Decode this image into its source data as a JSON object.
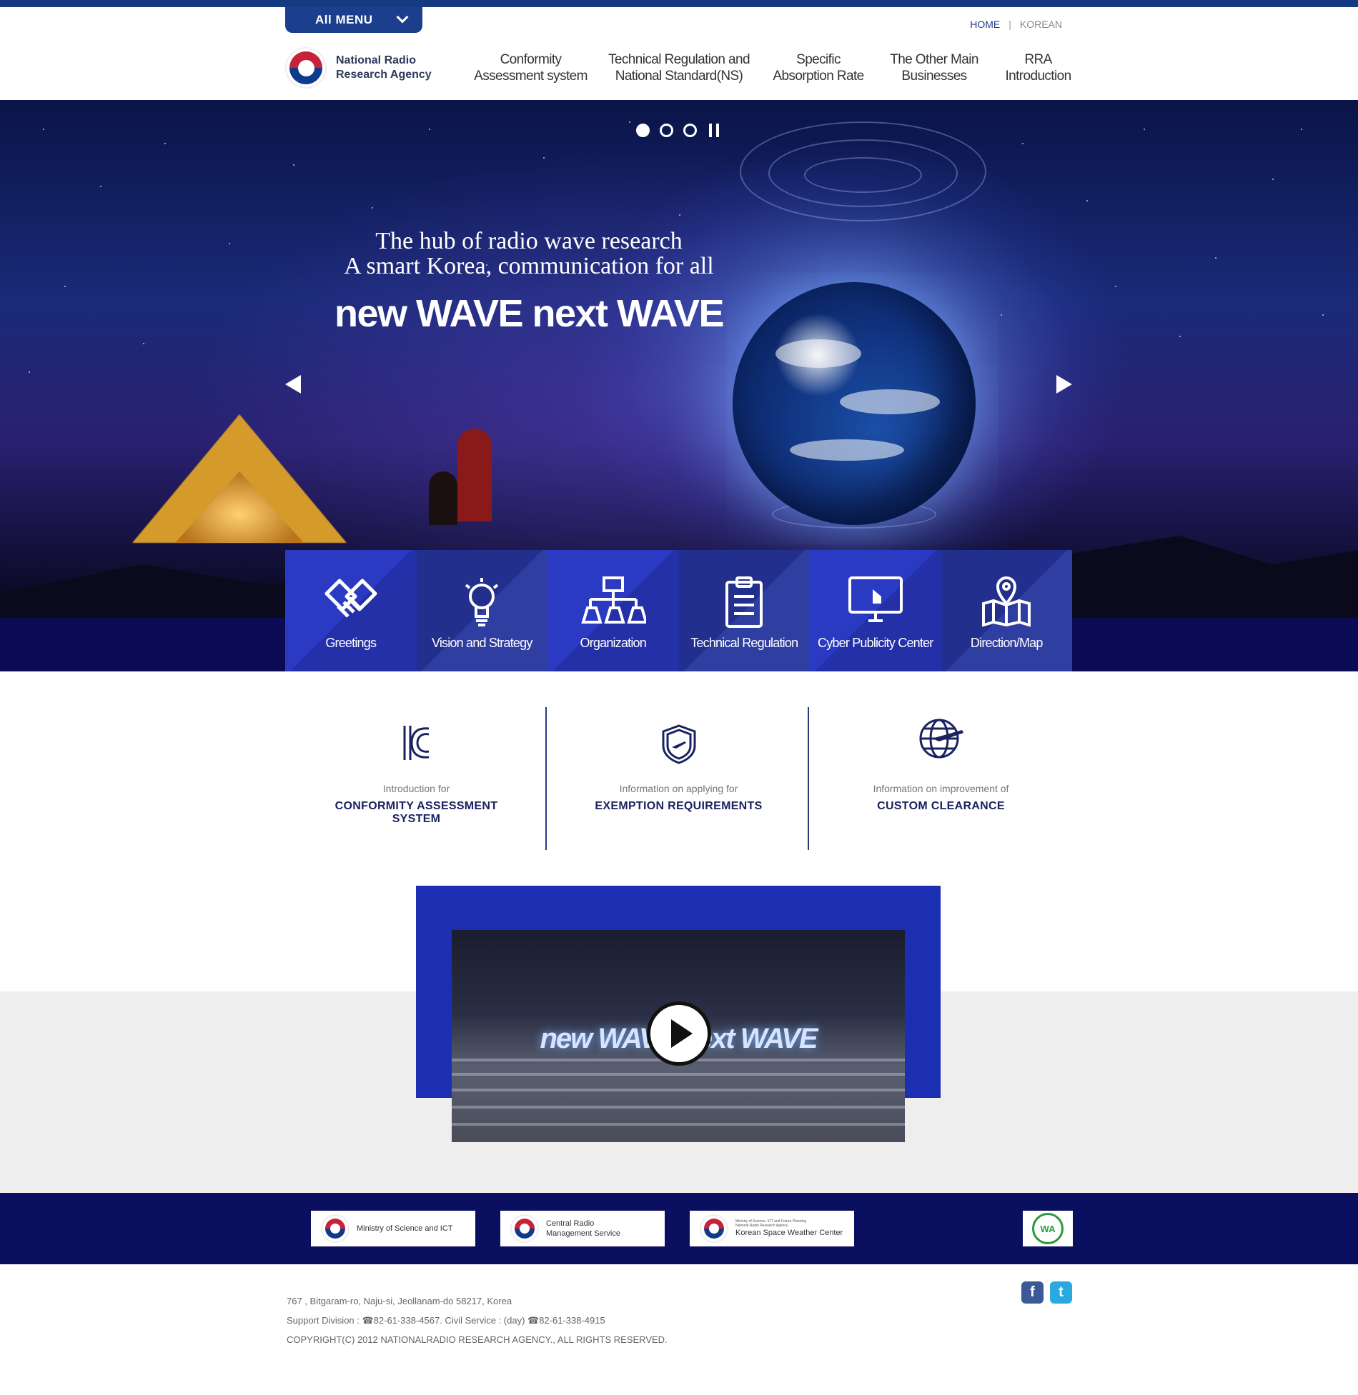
{
  "header": {
    "all_menu": "All  MENU",
    "util": {
      "home": "HOME",
      "korean": "KOREAN",
      "sep": "|"
    },
    "logo": {
      "line1": "National Radio",
      "line2": "Research Agency"
    },
    "gnb": [
      {
        "line1": "Conformity",
        "line2": "Assessment system"
      },
      {
        "line1": "Technical Regulation and",
        "line2": "National Standard(NS)"
      },
      {
        "line1": "Specific",
        "line2": "Absorption Rate"
      },
      {
        "line1": "The Other Main",
        "line2": "Businesses"
      },
      {
        "line1": "RRA",
        "line2": "Introduction"
      }
    ]
  },
  "hero": {
    "line1": "The hub of radio wave research",
    "line2": "A smart Korea, communication for all",
    "headline": "new WAVE next WAVE",
    "active_slide": 1,
    "slide_count": 3
  },
  "quick_links": [
    {
      "label": "Greetings",
      "icon": "handshake-icon"
    },
    {
      "label": "Vision and Strategy",
      "icon": "lightbulb-icon"
    },
    {
      "label": "Organization",
      "icon": "org-chart-icon"
    },
    {
      "label": "Technical Regulation",
      "icon": "clipboard-icon"
    },
    {
      "label": "Cyber Publicity Center",
      "icon": "monitor-icon"
    },
    {
      "label": "Direction/Map",
      "icon": "map-pin-icon"
    }
  ],
  "intro": [
    {
      "small": "Introduction for",
      "big": "CONFORMITY ASSESSMENT SYSTEM",
      "icon": "kc-mark-icon"
    },
    {
      "small": "Information on applying for",
      "big": "EXEMPTION REQUIREMENTS",
      "icon": "shield-plane-icon"
    },
    {
      "small": "Information on improvement of",
      "big": "CUSTOM CLEARANCE",
      "icon": "globe-plane-icon"
    }
  ],
  "video": {
    "title": "new WAVE next WAVE"
  },
  "footer": {
    "banners": [
      {
        "text": "Ministry of Science and ICT"
      },
      {
        "line1": "Central Radio",
        "line2": "Management Service"
      },
      {
        "tiny1": "Ministry of Science, ICT and Future Planning",
        "tiny2": "National Radio Research Agency",
        "text": "Korean Space Weather Center"
      }
    ],
    "wa_badge": "WA",
    "address": "767 , Bitgaram-ro, Naju-si, Jeollanam-do 58217, Korea",
    "contact": "Support Division : ☎82-61-338-4567. Civil Service : (day) ☎82-61-338-4915",
    "copyright": "COPYRIGHT(C) 2012 NATIONALRADIO RESEARCH AGENCY., ALL RIGHTS RESERVED.",
    "sns": {
      "facebook": "f",
      "twitter": "t"
    }
  },
  "colors": {
    "brand_navy": "#1b3f8c",
    "quick_blue": "#2b3ac2",
    "quick_dark": "#1e2a8a",
    "footer_navy": "#0b0f60",
    "video_frame": "#1c2fb3"
  }
}
